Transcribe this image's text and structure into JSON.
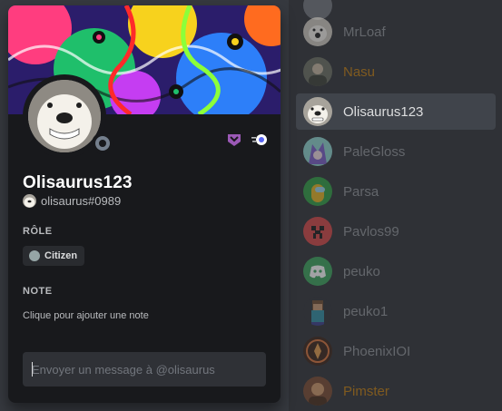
{
  "profile": {
    "username": "Olisaurus123",
    "tag": "olisaurus#0989",
    "role_section_title": "RÔLE",
    "role_name": "Citizen",
    "note_section_title": "NOTE",
    "note_placeholder": "Clique pour ajouter une note",
    "message_placeholder": "Envoyer un message à @olisaurus",
    "status": "offline",
    "badges": [
      "hypesquad-balance-icon",
      "nitro-boost-icon"
    ],
    "colors": {
      "popout_bg": "#18191c",
      "role_dot": "#95a5a6",
      "hypesquad_badge": "#9b59b6",
      "status_offline": "#747f8d"
    }
  },
  "members": [
    {
      "name": "",
      "avatar_icon": "grey-avatar-icon"
    },
    {
      "name": "MrLoaf",
      "avatar_icon": "dog-avatar-icon"
    },
    {
      "name": "Nasu",
      "avatar_icon": "photo-avatar-icon",
      "name_color": "#c27c0e"
    },
    {
      "name": "Olisaurus123",
      "avatar_icon": "dog-avatar-icon",
      "selected": true
    },
    {
      "name": "PaleGloss",
      "avatar_icon": "anime-avatar-icon"
    },
    {
      "name": "Parsa",
      "avatar_icon": "among-us-avatar-icon"
    },
    {
      "name": "Pavlos99",
      "avatar_icon": "creeper-avatar-icon"
    },
    {
      "name": "peuko",
      "avatar_icon": "discord-logo-avatar-icon"
    },
    {
      "name": "peuko1",
      "avatar_icon": "minecraft-avatar-icon"
    },
    {
      "name": "PhoenixIOI",
      "avatar_icon": "phoenix-avatar-icon"
    },
    {
      "name": "Pimster",
      "avatar_icon": "photo-avatar-icon",
      "name_color": "#c27c0e"
    }
  ]
}
